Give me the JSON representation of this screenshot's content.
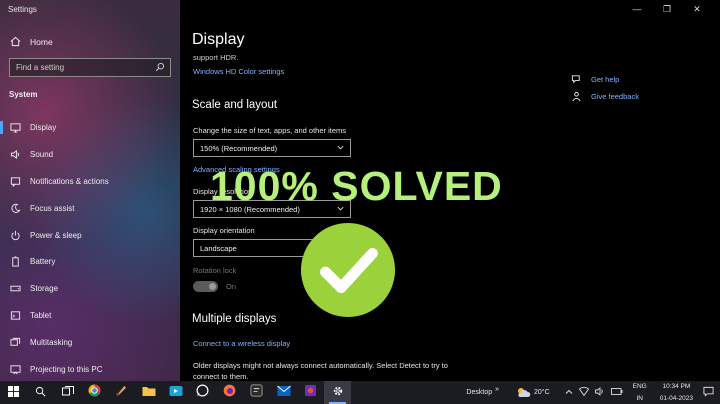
{
  "window": {
    "title": "Settings",
    "controls": [
      "—",
      "❐",
      "✕"
    ]
  },
  "sidebar": {
    "home": "Home",
    "search_placeholder": "Find a setting",
    "section": "System",
    "items": [
      {
        "label": "Display",
        "icon": "monitor-icon"
      },
      {
        "label": "Sound",
        "icon": "speaker-icon"
      },
      {
        "label": "Notifications & actions",
        "icon": "notification-icon"
      },
      {
        "label": "Focus assist",
        "icon": "moon-icon"
      },
      {
        "label": "Power & sleep",
        "icon": "power-icon"
      },
      {
        "label": "Battery",
        "icon": "battery-icon"
      },
      {
        "label": "Storage",
        "icon": "storage-icon"
      },
      {
        "label": "Tablet",
        "icon": "tablet-icon"
      },
      {
        "label": "Multitasking",
        "icon": "multitasking-icon"
      },
      {
        "label": "Projecting to this PC",
        "icon": "projector-icon"
      }
    ]
  },
  "main": {
    "title": "Display",
    "support_text": "support HDR.",
    "hdr_link": "Windows HD Color settings",
    "scale_heading": "Scale and layout",
    "scale_label": "Change the size of text, apps, and other items",
    "scale_value": "150% (Recommended)",
    "advanced_link": "Advanced scaling settings",
    "resolution_label": "Display resolution",
    "resolution_value": "1920 × 1080 (Recommended)",
    "orientation_label": "Display orientation",
    "orientation_value": "Landscape",
    "rotation_label": "Rotation lock",
    "rotation_state": "On",
    "multi_heading": "Multiple displays",
    "wireless_link": "Connect to a wireless display",
    "detect_text": "Older displays might not always connect automatically. Select Detect to try to connect to them."
  },
  "help": {
    "get_help": "Get help",
    "feedback": "Give feedback"
  },
  "overlay": {
    "text": "100% SOLVED",
    "color": "#b5f07a",
    "check_color": "#9bd23c"
  },
  "taskbar": {
    "desktop": "Desktop",
    "chevron": "»",
    "temperature": "20°C",
    "lang_top": "ENG",
    "lang_bottom": "IN",
    "time": "10:34 PM",
    "date": "01-04-2023"
  },
  "colors": {
    "accent": "#4da3ff",
    "link": "#7fb3ff"
  }
}
